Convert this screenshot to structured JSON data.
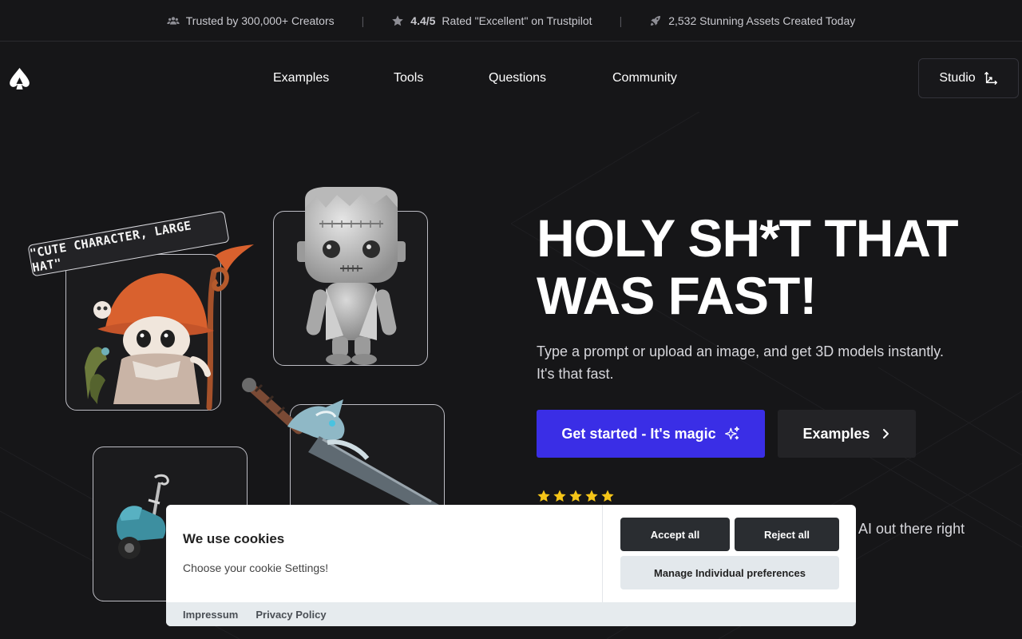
{
  "topbar": {
    "creators": "Trusted by 300,000+ Creators",
    "rating_value": "4.4/5",
    "rating_text": "Rated \"Excellent\" on Trustpilot",
    "assets": "2,532 Stunning Assets Created Today",
    "separator": "|"
  },
  "nav": {
    "items": [
      "Examples",
      "Tools",
      "Questions",
      "Community"
    ],
    "studio_label": "Studio"
  },
  "hero": {
    "headline_line1": "HOLY SH*T THAT",
    "headline_line2": "WAS FAST!",
    "subtitle_line1": "Type a prompt or upload an image, and get 3D models instantly.",
    "subtitle_line2": "It's that fast.",
    "cta_label": "Get started - It's magic",
    "examples_label": "Examples",
    "stars": 5,
    "partial_text": "AI out there right",
    "prompt_tag": "\"CUTE CHARACTER, LARGE HAT\""
  },
  "cookie": {
    "title": "We use cookies",
    "text": "Choose your cookie Settings!",
    "accept_label": "Accept all",
    "reject_label": "Reject all",
    "manage_label": "Manage Individual preferences",
    "footer_links": [
      "Impressum",
      "Privacy Policy"
    ]
  },
  "colors": {
    "background": "#161618",
    "cta": "#3a2ee6",
    "star": "#f5c518"
  }
}
